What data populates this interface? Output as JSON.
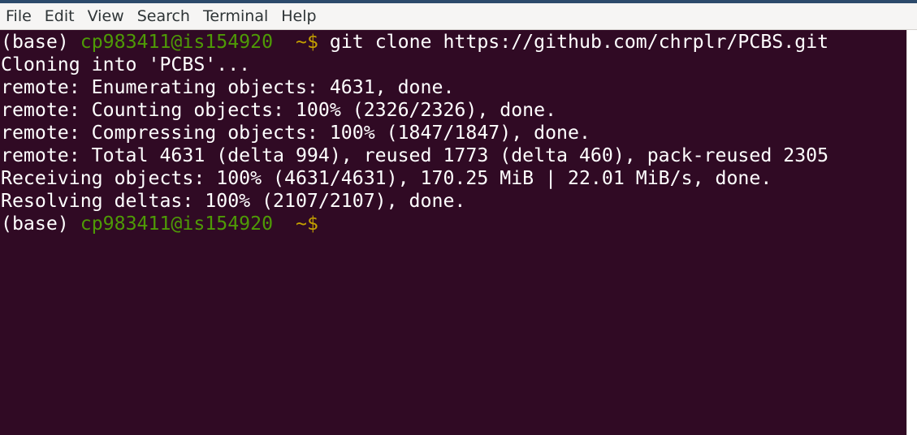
{
  "menubar": {
    "items": [
      "File",
      "Edit",
      "View",
      "Search",
      "Terminal",
      "Help"
    ]
  },
  "terminal": {
    "prompt1": {
      "env": "(base) ",
      "user_host": "cp983411@is154920",
      "path": "  ~$",
      "command": " git clone https://github.com/chrplr/PCBS.git"
    },
    "output": [
      "Cloning into 'PCBS'...",
      "remote: Enumerating objects: 4631, done.",
      "remote: Counting objects: 100% (2326/2326), done.",
      "remote: Compressing objects: 100% (1847/1847), done.",
      "remote: Total 4631 (delta 994), reused 1773 (delta 460), pack-reused 2305",
      "Receiving objects: 100% (4631/4631), 170.25 MiB | 22.01 MiB/s, done.",
      "Resolving deltas: 100% (2107/2107), done."
    ],
    "prompt2": {
      "env": "(base) ",
      "user_host": "cp983411@is154920",
      "path": "  ~$",
      "command": ""
    }
  },
  "colors": {
    "background": "#300a24",
    "foreground": "#ffffff",
    "user_host": "#4e9a06",
    "path": "#c4a000",
    "menubar": "#f6f5f4"
  }
}
